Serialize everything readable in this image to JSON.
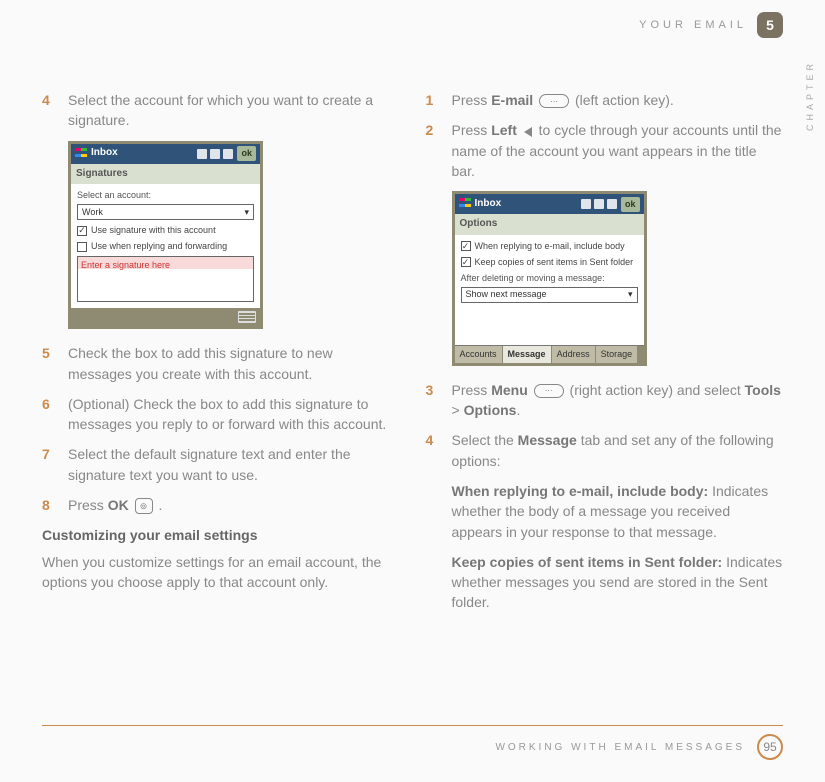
{
  "header": {
    "section": "YOUR EMAIL",
    "chapter_num": "5",
    "chapter_label": "CHAPTER"
  },
  "left": {
    "step4": {
      "num": "4",
      "text": "Select the account for which you want to create a signature."
    },
    "phone1": {
      "title": "Inbox",
      "ok": "ok",
      "subbar": "Signatures",
      "select_label": "Select an account:",
      "select_value": "Work",
      "chk1": "Use signature with this account",
      "chk2": "Use when replying and forwarding",
      "sig_text": "Enter a signature here"
    },
    "step5": {
      "num": "5",
      "text": "Check the box to add this signature to new messages you create with this account."
    },
    "step6": {
      "num": "6",
      "text": "(Optional)  Check the box to add this signature to messages you reply to or forward with this account."
    },
    "step7": {
      "num": "7",
      "text": "Select the default signature text and enter the signature text you want to use."
    },
    "step8": {
      "num": "8",
      "pre": "Press ",
      "bold": "OK",
      "post": " ."
    },
    "heading": "Customizing your email settings",
    "para": "When you customize settings for an email account, the options you choose apply to that account only."
  },
  "right": {
    "step1": {
      "num": "1",
      "pre": "Press ",
      "bold": "E-mail",
      "post": " (left action key)."
    },
    "step2": {
      "num": "2",
      "pre": "Press ",
      "bold": "Left",
      "post": " to cycle through your accounts until the name of the account you want appears in the title bar."
    },
    "phone2": {
      "title": "Inbox",
      "ok": "ok",
      "subbar": "Options",
      "chk1": "When replying to e-mail, include body",
      "chk2": "Keep copies of sent items in Sent folder",
      "after_label": "After deleting or moving a message:",
      "select_value": "Show next message",
      "tabs": [
        "Accounts",
        "Message",
        "Address",
        "Storage"
      ],
      "active_tab": 1
    },
    "step3": {
      "num": "3",
      "pre": "Press ",
      "bold1": "Menu",
      "mid": " (right action key) and select ",
      "bold2": "Tools",
      "gt": " > ",
      "bold3": "Options",
      "post": "."
    },
    "step4": {
      "num": "4",
      "pre": "Select the ",
      "bold": "Message",
      "post": " tab and set any of the following options:"
    },
    "opt1": {
      "bold": "When replying to e-mail, include body:",
      "text": " Indicates whether the body of a message you received appears in your response to that message."
    },
    "opt2": {
      "bold": "Keep copies of sent items in Sent folder:",
      "text": " Indicates whether messages you send are stored in the Sent folder."
    }
  },
  "footer": {
    "text": "WORKING WITH EMAIL MESSAGES",
    "page": "95"
  }
}
